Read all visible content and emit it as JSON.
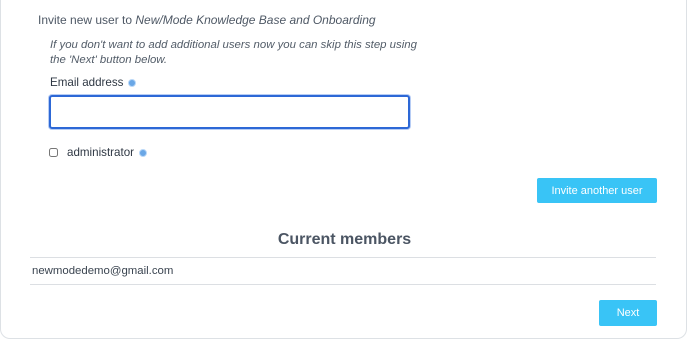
{
  "invite": {
    "heading_prefix": "Invite new user to ",
    "heading_name": "New/Mode Knowledge Base and Onboarding",
    "help_text": "If you don't want to add additional users now you can skip this step using the 'Next' button below.",
    "email_label": "Email address",
    "email_value": "",
    "admin_label": "administrator",
    "admin_checked": false,
    "invite_button": "Invite another user"
  },
  "members": {
    "title": "Current members",
    "items": [
      {
        "email": "newmodedemo@gmail.com"
      }
    ]
  },
  "footer": {
    "next_button": "Next"
  },
  "colors": {
    "accent_button": "#39c4f6",
    "input_focus": "#2d68d6",
    "info_icon": "#6aa7e6"
  }
}
